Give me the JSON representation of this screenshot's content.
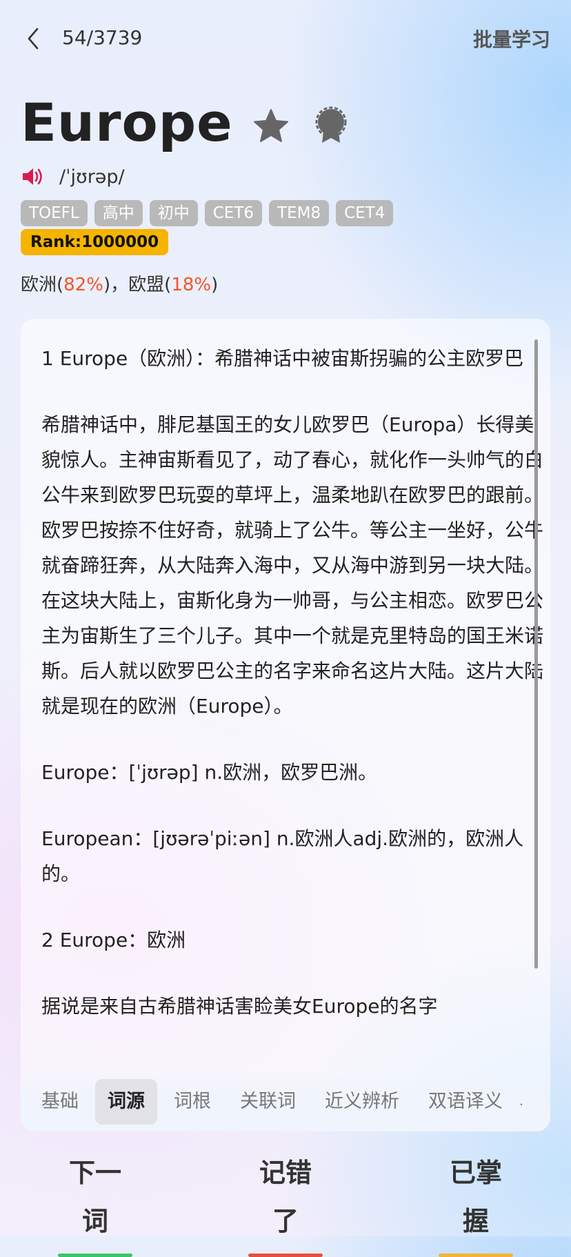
{
  "header": {
    "counter": "54/3739",
    "batch_label": "批量学习"
  },
  "word": {
    "text": "Europe",
    "phonetic": "/ˈjʊrəp/",
    "tags": [
      "TOEFL",
      "高中",
      "初中",
      "CET6",
      "TEM8",
      "CET4"
    ],
    "rank": "Rank:1000000",
    "meanings": [
      {
        "word": "欧洲",
        "pct": "82%"
      },
      {
        "word": "欧盟",
        "pct": "18%"
      }
    ],
    "meaning_sep": "，"
  },
  "etymology": {
    "paragraphs": [
      "1 Europe（欧洲）：希腊神话中被宙斯拐骗的公主欧罗巴",
      "希腊神话中，腓尼基国王的女儿欧罗巴（Europa）长得美貌惊人。主神宙斯看见了，动了春心，就化作一头帅气的白公牛来到欧罗巴玩耍的草坪上，温柔地趴在欧罗巴的跟前。欧罗巴按捺不住好奇，就骑上了公牛。等公主一坐好，公牛就奋蹄狂奔，从大陆奔入海中，又从海中游到另一块大陆。在这块大陆上，宙斯化身为一帅哥，与公主相恋。欧罗巴公主为宙斯生了三个儿子。其中一个就是克里特岛的国王米诺斯。后人就以欧罗巴公主的名字来命名这片大陆。这片大陆就是现在的欧洲（Europe）。",
      "Europe：[ˈjʊrəp] n.欧洲，欧罗巴洲。",
      "European：[jʊərəˈpiːən] n.欧洲人adj.欧洲的，欧洲人的。",
      "2 Europe：欧洲",
      "据说是来自古希腊神话害睑美女Europe的名字"
    ]
  },
  "tabs": [
    {
      "label": "基础",
      "active": false
    },
    {
      "label": "词源",
      "active": true
    },
    {
      "label": "词根",
      "active": false
    },
    {
      "label": "关联词",
      "active": false
    },
    {
      "label": "近义辨析",
      "active": false
    },
    {
      "label": "双语译义",
      "active": false
    }
  ],
  "actions": [
    {
      "label": "下一词",
      "color": "#3cc36c"
    },
    {
      "label": "记错了",
      "color": "#e3503e"
    },
    {
      "label": "已掌握",
      "color": "#f0b43c"
    }
  ],
  "icons": {
    "back": "chevron-left-icon",
    "favorite": "star-icon",
    "badge": "badge-icon",
    "audio": "speaker-icon"
  },
  "colors": {
    "rank_bg": "#f5b400",
    "tag_bg": "#b9b9b9",
    "pct": "#f0562a",
    "speaker": "#d81b50"
  }
}
